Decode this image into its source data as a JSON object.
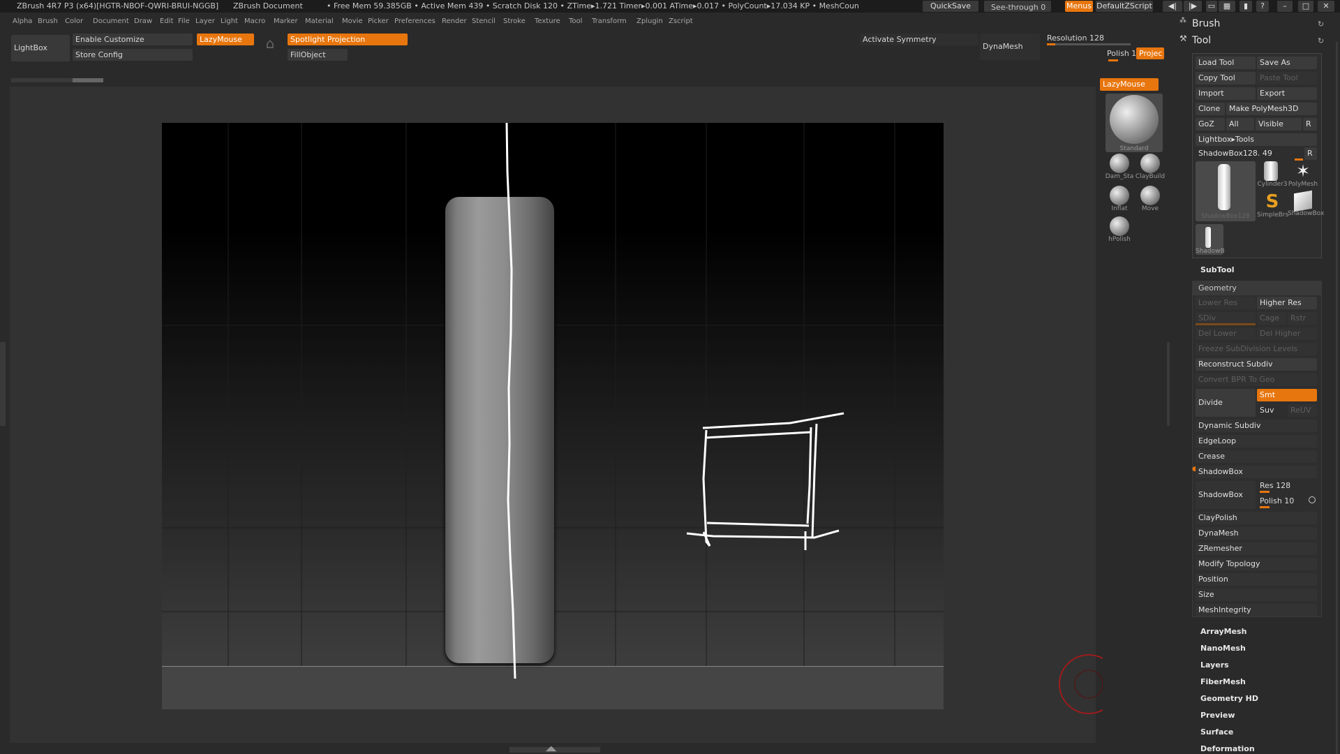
{
  "titlebar": {
    "app": "ZBrush 4R7 P3 (x64)[HGTR-NBOF-QWRI-BRUI-NGGB]",
    "document": "ZBrush Document",
    "stats": "• Free Mem 59.385GB • Active Mem 439 • Scratch Disk 120 • ZTime▸1.721 Timer▸0.001 ATime▸0.017 • PolyCount▸17.034 KP • MeshCoun",
    "quicksave": "QuickSave",
    "seethrough": "See-through 0",
    "menus": "Menus",
    "defaultzscript": "DefaultZScript"
  },
  "menubar": [
    "Alpha",
    "Brush",
    "Color",
    "Document",
    "Draw",
    "Edit",
    "File",
    "Layer",
    "Light",
    "Macro",
    "Marker",
    "Material",
    "Movie",
    "Picker",
    "Preferences",
    "Render",
    "Stencil",
    "Stroke",
    "Texture",
    "Tool",
    "Transform",
    "Zplugin",
    "Zscript"
  ],
  "shelf": {
    "lightbox": "LightBox",
    "enable_customize": "Enable Customize",
    "store_config": "Store Config",
    "lazymouse": "LazyMouse",
    "spotlight": "Spotlight Projection",
    "fillobject": "FillObject",
    "activate_symmetry": "Activate Symmetry",
    "dynamesh": "DynaMesh",
    "resolution": "Resolution 128",
    "polish": "Polish 1",
    "project": "Projec"
  },
  "leftpalette": {
    "lazymouse": "LazyMouse",
    "current_brush": "Standard",
    "brushes": [
      "Dam_Sta",
      "ClayBuild",
      "Inflat",
      "Move",
      "hPolish"
    ]
  },
  "tool": {
    "brush_title": "Brush",
    "tool_title": "Tool",
    "load_tool": "Load Tool",
    "save_as": "Save As",
    "copy_tool": "Copy Tool",
    "paste_tool": "Paste Tool",
    "import": "Import",
    "export": "Export",
    "clone": "Clone",
    "make_polymesh": "Make PolyMesh3D",
    "goz": "GoZ",
    "all": "All",
    "visible": "Visible",
    "r": "R",
    "lightbox_tools": "Lightbox▸Tools",
    "current_tool": "ShadowBox128. 49",
    "tool_thumbs": [
      "ShadowBox128",
      "Cylinder3",
      "PolyMesh",
      "SimpleBrs",
      "ShadowBox",
      "ShadowB"
    ],
    "subtool": "SubTool",
    "geometry": "Geometry",
    "lower_res": "Lower Res",
    "higher_res": "Higher Res",
    "sdiv": "SDiv",
    "cage": "Cage",
    "rstr": "Rstr",
    "del_lower": "Del Lower",
    "del_higher": "Del Higher",
    "freeze": "Freeze SubDivision Levels",
    "reconstruct": "Reconstruct Subdiv",
    "convert_bpr": "Convert BPR To Geo",
    "divide": "Divide",
    "smt": "Smt",
    "suv": "Suv",
    "reuv": "ReUV",
    "dynamic_subdiv": "Dynamic Subdiv",
    "edgeloop": "EdgeLoop",
    "crease": "Crease",
    "shadowbox_head": "ShadowBox",
    "shadowbox_btn": "ShadowBox",
    "res": "Res 128",
    "polish": "Polish 10",
    "claypolish": "ClayPolish",
    "dynamesh": "DynaMesh",
    "zremesher": "ZRemesher",
    "modify_topology": "Modify Topology",
    "position": "Position",
    "size": "Size",
    "meshintegrity": "MeshIntegrity",
    "sections": [
      "ArrayMesh",
      "NanoMesh",
      "Layers",
      "FiberMesh",
      "Geometry HD",
      "Preview",
      "Surface",
      "Deformation"
    ]
  },
  "colors": {
    "accent": "#e8760e",
    "panel": "#2a2a2a",
    "button": "#3b3b3b"
  }
}
